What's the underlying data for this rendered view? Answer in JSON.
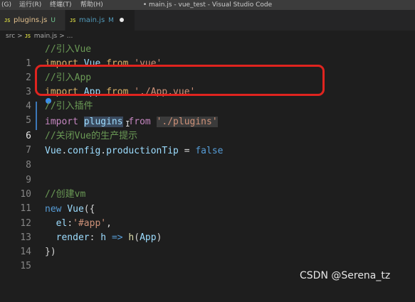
{
  "menubar": {
    "items": [
      "(G)",
      "运行(R)",
      "终端(T)",
      "帮助(H)"
    ],
    "window_title": "• main.js - vue_test - Visual Studio Code"
  },
  "tabs": [
    {
      "icon": "js-icon",
      "label": "plugins.js",
      "status": "U"
    },
    {
      "icon": "js-icon",
      "label": "main.js",
      "status": "M"
    }
  ],
  "breadcrumb": [
    "src",
    "main.js",
    "..."
  ],
  "editor": {
    "active_line": 6,
    "lines": [
      {
        "num": "1",
        "text": "//引入Vue"
      },
      {
        "num": "2",
        "text": "import Vue from 'vue'"
      },
      {
        "num": "3",
        "text": "//引入App"
      },
      {
        "num": "4",
        "text": "import App from './App.vue'"
      },
      {
        "num": "5",
        "text": "//引入插件"
      },
      {
        "num": "6",
        "text": "import plugins from './plugins'"
      },
      {
        "num": "7",
        "text": "//关闭Vue的生产提示"
      },
      {
        "num": "8",
        "text": "Vue.config.productionTip = false"
      },
      {
        "num": "9",
        "text": ""
      },
      {
        "num": "10",
        "text": ""
      },
      {
        "num": "11",
        "text": "//创建vm"
      },
      {
        "num": "12",
        "text": "new Vue({"
      },
      {
        "num": "13",
        "text": "  el:'#app',"
      },
      {
        "num": "14",
        "text": "  render: h => h(App)"
      },
      {
        "num": "15",
        "text": "})"
      }
    ]
  },
  "watermark": "CSDN @Serena_tz",
  "colors": {
    "annotation_box": "#e0241f",
    "accent": "#3c78b9"
  }
}
